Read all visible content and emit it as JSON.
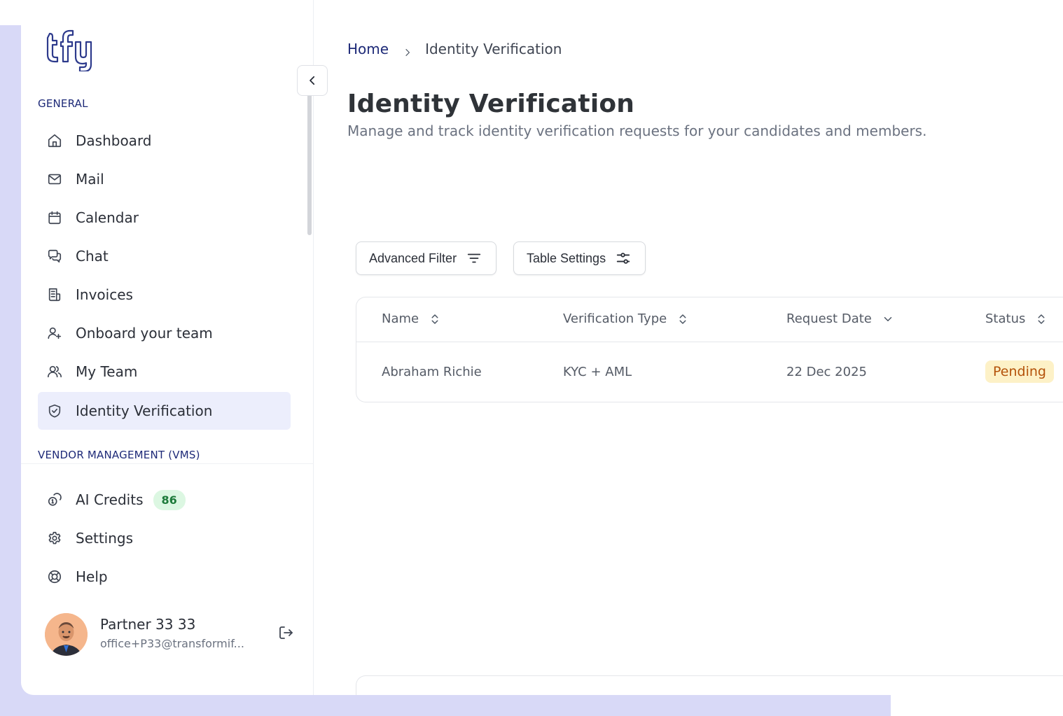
{
  "sidebar": {
    "logo_text": "tfy",
    "general_label": "GENERAL",
    "items": [
      {
        "label": "Dashboard",
        "icon": "home-icon"
      },
      {
        "label": "Mail",
        "icon": "mail-icon"
      },
      {
        "label": "Calendar",
        "icon": "calendar-icon"
      },
      {
        "label": "Chat",
        "icon": "chat-icon"
      },
      {
        "label": "Invoices",
        "icon": "invoice-icon"
      },
      {
        "label": "Onboard your team",
        "icon": "user-plus-icon"
      },
      {
        "label": "My Team",
        "icon": "users-icon"
      },
      {
        "label": "Identity Verification",
        "icon": "shield-check-icon",
        "active": true
      }
    ],
    "vms_label": "VENDOR MANAGEMENT (VMS)",
    "bottom_items": [
      {
        "label": "AI Credits",
        "icon": "coins-icon",
        "badge": "86"
      },
      {
        "label": "Settings",
        "icon": "gear-icon"
      },
      {
        "label": "Help",
        "icon": "lifebuoy-icon"
      }
    ],
    "user": {
      "name": "Partner 33 33",
      "email": "office+P33@transformif..."
    }
  },
  "breadcrumb": {
    "home": "Home",
    "current": "Identity Verification"
  },
  "page": {
    "title": "Identity Verification",
    "subtitle": "Manage and track identity verification requests for your candidates and members."
  },
  "toolbar": {
    "advanced_filter": "Advanced Filter",
    "table_settings": "Table Settings"
  },
  "table": {
    "columns": [
      "Name",
      "Verification Type",
      "Request Date",
      "Status"
    ],
    "rows": [
      {
        "name": "Abraham Richie",
        "type": "KYC + AML",
        "date": "22 Dec 2025",
        "status": "Pending"
      }
    ]
  },
  "colors": {
    "accent": "#1e2a78",
    "active_bg": "#eceefc",
    "frame_bg": "#d8d9f7",
    "pending_bg": "#fdf1c7",
    "pending_text": "#b4520a",
    "badge_bg": "#dcf7e2",
    "badge_text": "#1d7a3a"
  }
}
